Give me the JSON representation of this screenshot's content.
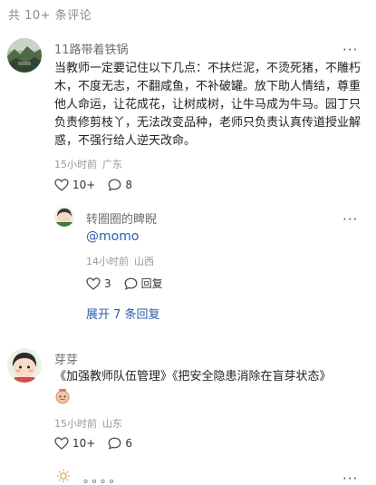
{
  "header": {
    "count_label": "共 10+ 条评论"
  },
  "comments": [
    {
      "username": "11路带着铁锅",
      "text": "当教师一定要记住以下几点：不扶烂泥，不烫死猪，不雕朽木，不度无志，不翻咸鱼，不补破罐。放下助人情结，尊重他人命运，让花成花，让树成树，让牛马成为牛马。园丁只负责修剪枝丫，无法改变品种，老师只负责认真传道授业解惑，不强行给人逆天改命。",
      "time": "15小时前",
      "location": "广东",
      "likes": "10+",
      "replies_count": "8",
      "sub_reply": {
        "username": "转圈圈的睥睨",
        "text": "@momo",
        "time": "14小时前",
        "location": "山西",
        "likes": "3",
        "reply_label": "回复"
      },
      "expand_label": "展开 7 条回复"
    },
    {
      "username": "芽芽",
      "text": "《加强教师队伍管理》《把安全隐患消除在盲芽状态》",
      "time": "15小时前",
      "location": "山东",
      "likes": "10+",
      "replies_count": "6"
    }
  ],
  "footer": {
    "dots": "。。。。"
  },
  "more_glyph": "···"
}
